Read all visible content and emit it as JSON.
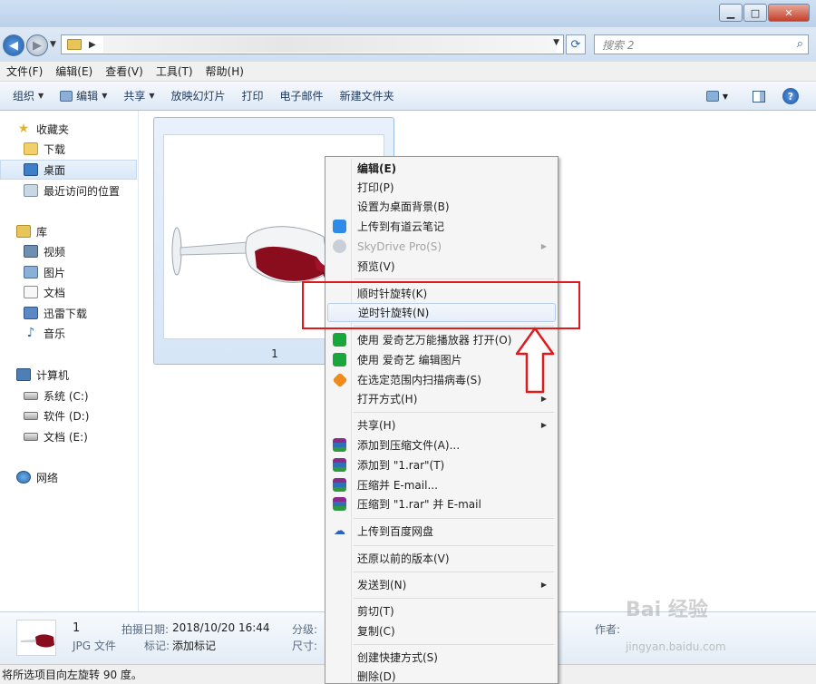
{
  "search": {
    "placeholder": "搜索 2"
  },
  "menubar": [
    "文件(F)",
    "编辑(E)",
    "查看(V)",
    "工具(T)",
    "帮助(H)"
  ],
  "toolbar": {
    "organize": "组织",
    "edit": "编辑",
    "share": "共享",
    "slideshow": "放映幻灯片",
    "print": "打印",
    "email": "电子邮件",
    "new_folder": "新建文件夹"
  },
  "nav": {
    "favorites": "收藏夹",
    "downloads": "下载",
    "desktop": "桌面",
    "recent": "最近访问的位置",
    "libraries": "库",
    "videos": "视频",
    "pictures": "图片",
    "documents": "文档",
    "xunlei": "迅雷下载",
    "music": "音乐",
    "computer": "计算机",
    "drive_c": "系统 (C:)",
    "drive_d": "软件 (D:)",
    "drive_e": "文档 (E:)",
    "network": "网络"
  },
  "file": {
    "name": "1"
  },
  "details": {
    "name": "1",
    "type": "JPG 文件",
    "date_label": "拍摄日期:",
    "date_value": "2018/10/20 16:44",
    "tag_label": "标记:",
    "tag_value": "添加标记",
    "rating_label": "分级:",
    "size_label": "尺寸:",
    "author_label": "作者:"
  },
  "status": "将所选项目向左旋转 90 度。",
  "context_menu": {
    "edit": "编辑(E)",
    "print": "打印(P)",
    "set_bg": "设置为桌面背景(B)",
    "youdao": "上传到有道云笔记",
    "skydrive": "SkyDrive Pro(S)",
    "preview": "预览(V)",
    "rotate_cw": "顺时针旋转(K)",
    "rotate_ccw": "逆时针旋转(N)",
    "iqiyi_open": "使用 爱奇艺万能播放器 打开(O)",
    "iqiyi_edit": "使用 爱奇艺 编辑图片",
    "scan": "在选定范围内扫描病毒(S)",
    "open_with": "打开方式(H)",
    "share": "共享(H)",
    "add_archive": "添加到压缩文件(A)...",
    "add_rar": "添加到 \"1.rar\"(T)",
    "compress_email": "压缩并 E-mail...",
    "compress_rar_email": "压缩到 \"1.rar\" 并 E-mail",
    "baidu": "上传到百度网盘",
    "restore": "还原以前的版本(V)",
    "send_to": "发送到(N)",
    "cut": "剪切(T)",
    "copy": "复制(C)",
    "shortcut": "创建快捷方式(S)",
    "delete": "删除(D)"
  },
  "watermark": {
    "text": "Bai 经验",
    "url": "jingyan.baidu.com"
  },
  "colors": {
    "annotation": "#e0191d",
    "highlight": "#e6eef9"
  }
}
